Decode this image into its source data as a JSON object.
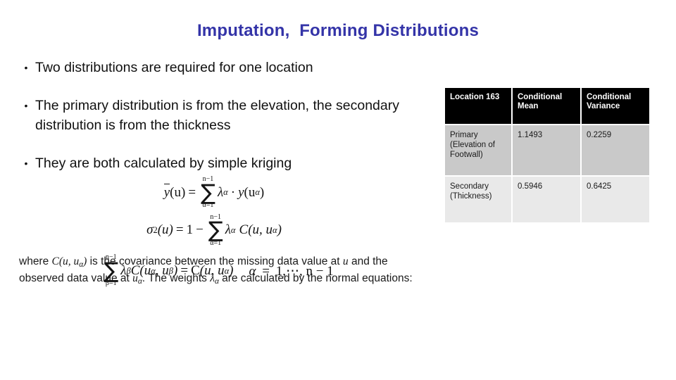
{
  "slide": {
    "title": "Imputation,  Forming Distributions",
    "title_color": "#3434a8",
    "background_color": "#ffffff"
  },
  "bullets": [
    {
      "marker": "•",
      "text": "Two distributions are required for one location"
    },
    {
      "marker": "•",
      "text": "The primary distribution is from the elevation, the secondary distribution is from the thickness"
    },
    {
      "marker": "•",
      "text": "They are both calculated by simple kriging"
    }
  ],
  "equations": {
    "eq1": {
      "lhs_var": "y",
      "lhs_arg": "(u)",
      "equals": "=",
      "sum_upper": "n−1",
      "sum_lower": "α=1",
      "sum_glyph": "∑",
      "term_lambda": "λ",
      "term_lambda_sub": "α",
      "middot": "·",
      "term_y": "y",
      "term_y_arg_open": "(u",
      "term_y_arg_sub": "α",
      "term_y_arg_close": ")"
    },
    "eq2": {
      "lhs_sigma": "σ",
      "lhs_sup": "2",
      "lhs_arg": "(u)",
      "equals": "=",
      "one": "1",
      "minus": "−",
      "sum_upper": "n−1",
      "sum_lower": "α=1",
      "sum_glyph": "∑",
      "term_lambda": "λ",
      "term_lambda_sub": "α",
      "term_C": "C",
      "term_C_arg": "(u, u",
      "term_C_sub": "α",
      "term_C_close": ")"
    },
    "eq3": {
      "sum_upper": "n−1",
      "sum_lower": "β=1",
      "sum_glyph": "∑",
      "lambda": "λ",
      "lambda_sub": "β",
      "C_left": "C",
      "C_left_open": "(u",
      "C_left_sub1": "α",
      "C_left_comma": ", u",
      "C_left_sub2": "β",
      "C_left_close": ")",
      "equals": "=",
      "C_right": "C",
      "C_right_open": "(u, u",
      "C_right_sub": "α",
      "C_right_close": ")",
      "condition_alpha": "α",
      "condition_equals": "=",
      "condition_value": "1,⋯, n − 1"
    }
  },
  "where_note": {
    "part1": "where ",
    "sym_C": "C(u, u",
    "sym_C_sub": "α",
    "sym_C_close": ")",
    "part2": " is the covariance between the missing data value at ",
    "sym_u": "u",
    "part3": " and the observed data value at ",
    "sym_u_alpha": "u",
    "sym_u_alpha_sub": "α",
    "part4": ". The weights ",
    "sym_lambda": "λ",
    "sym_lambda_sub": "α",
    "part5": " are calculated by the normal equations:"
  },
  "table": {
    "headers": [
      "Location 163",
      "Conditional Mean",
      "Conditional Variance"
    ],
    "header_lines": [
      [
        "Location 163"
      ],
      [
        "Conditional",
        "Mean"
      ],
      [
        "Conditional",
        "Variance"
      ]
    ],
    "value_color": "#c93f3f",
    "rows": [
      {
        "label_lines": [
          "Primary",
          "(Elevation of",
          "Footwall)"
        ],
        "conditional_mean": "1.1493",
        "conditional_variance": "0.2259"
      },
      {
        "label_lines": [
          "Secondary",
          "(Thickness)"
        ],
        "conditional_mean": "0.5946",
        "conditional_variance": "0.6425"
      }
    ]
  }
}
